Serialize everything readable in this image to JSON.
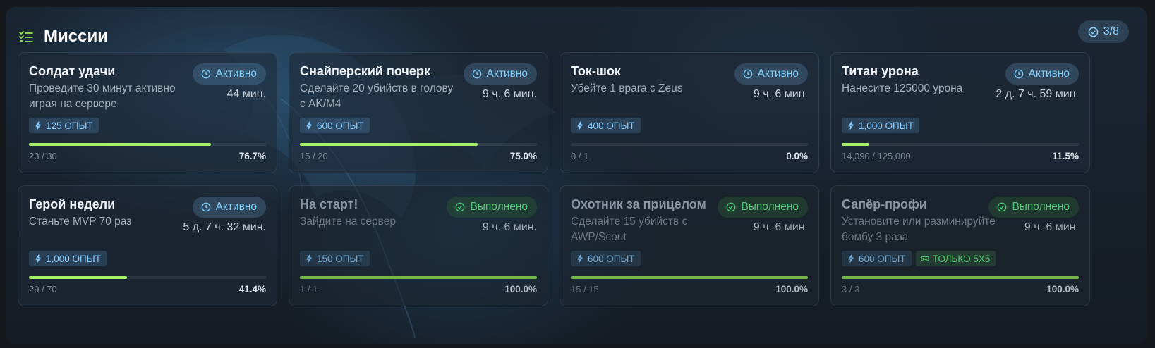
{
  "header": {
    "title": "Миссии",
    "counter": "3/8"
  },
  "colors": {
    "accent_green": "#a4f266",
    "active_blue": "#7fd0ff",
    "done_green": "#52c97a"
  },
  "missions": [
    {
      "name": "Солдат удачи",
      "desc": "Проведите 30 минут активно играя на сервере",
      "status": "Активно",
      "time": "44 мин.",
      "xp": "125 ОПЫТ",
      "extra": "",
      "progress": "23 / 30",
      "percent": "76.7%",
      "fill": 0.767
    },
    {
      "name": "Снайперский почерк",
      "desc": "Сделайте 20 убийств в голову с AK/M4",
      "status": "Активно",
      "time": "9 ч. 6 мин.",
      "xp": "600 ОПЫТ",
      "extra": "",
      "progress": "15 / 20",
      "percent": "75.0%",
      "fill": 0.75
    },
    {
      "name": "Ток-шок",
      "desc": "Убейте 1 врага с Zeus",
      "status": "Активно",
      "time": "9 ч. 6 мин.",
      "xp": "400 ОПЫТ",
      "extra": "",
      "progress": "0 / 1",
      "percent": "0.0%",
      "fill": 0
    },
    {
      "name": "Титан урона",
      "desc": "Нанесите 125000 урона",
      "status": "Активно",
      "time": "2 д. 7 ч. 59 мин.",
      "xp": "1,000 ОПЫТ",
      "extra": "",
      "progress": "14,390 / 125,000",
      "percent": "11.5%",
      "fill": 0.115
    },
    {
      "name": "Герой недели",
      "desc": "Станьте MVP 70 раз",
      "status": "Активно",
      "time": "5 д. 7 ч. 32 мин.",
      "xp": "1,000 ОПЫТ",
      "extra": "",
      "progress": "29 / 70",
      "percent": "41.4%",
      "fill": 0.414
    },
    {
      "name": "На старт!",
      "desc": "Зайдите на сервер",
      "status": "Выполнено",
      "time": "9 ч. 6 мин.",
      "xp": "150 ОПЫТ",
      "extra": "",
      "progress": "1 / 1",
      "percent": "100.0%",
      "fill": 1
    },
    {
      "name": "Охотник за прицелом",
      "desc": "Сделайте 15 убийств с AWP/Scout",
      "status": "Выполнено",
      "time": "9 ч. 6 мин.",
      "xp": "600 ОПЫТ",
      "extra": "",
      "progress": "15 / 15",
      "percent": "100.0%",
      "fill": 1
    },
    {
      "name": "Сапёр-профи",
      "desc": "Установите или разминируйте бомбу 3 раза",
      "status": "Выполнено",
      "time": "9 ч. 6 мин.",
      "xp": "600 ОПЫТ",
      "extra": "ТОЛЬКО 5X5",
      "progress": "3 / 3",
      "percent": "100.0%",
      "fill": 1
    }
  ]
}
